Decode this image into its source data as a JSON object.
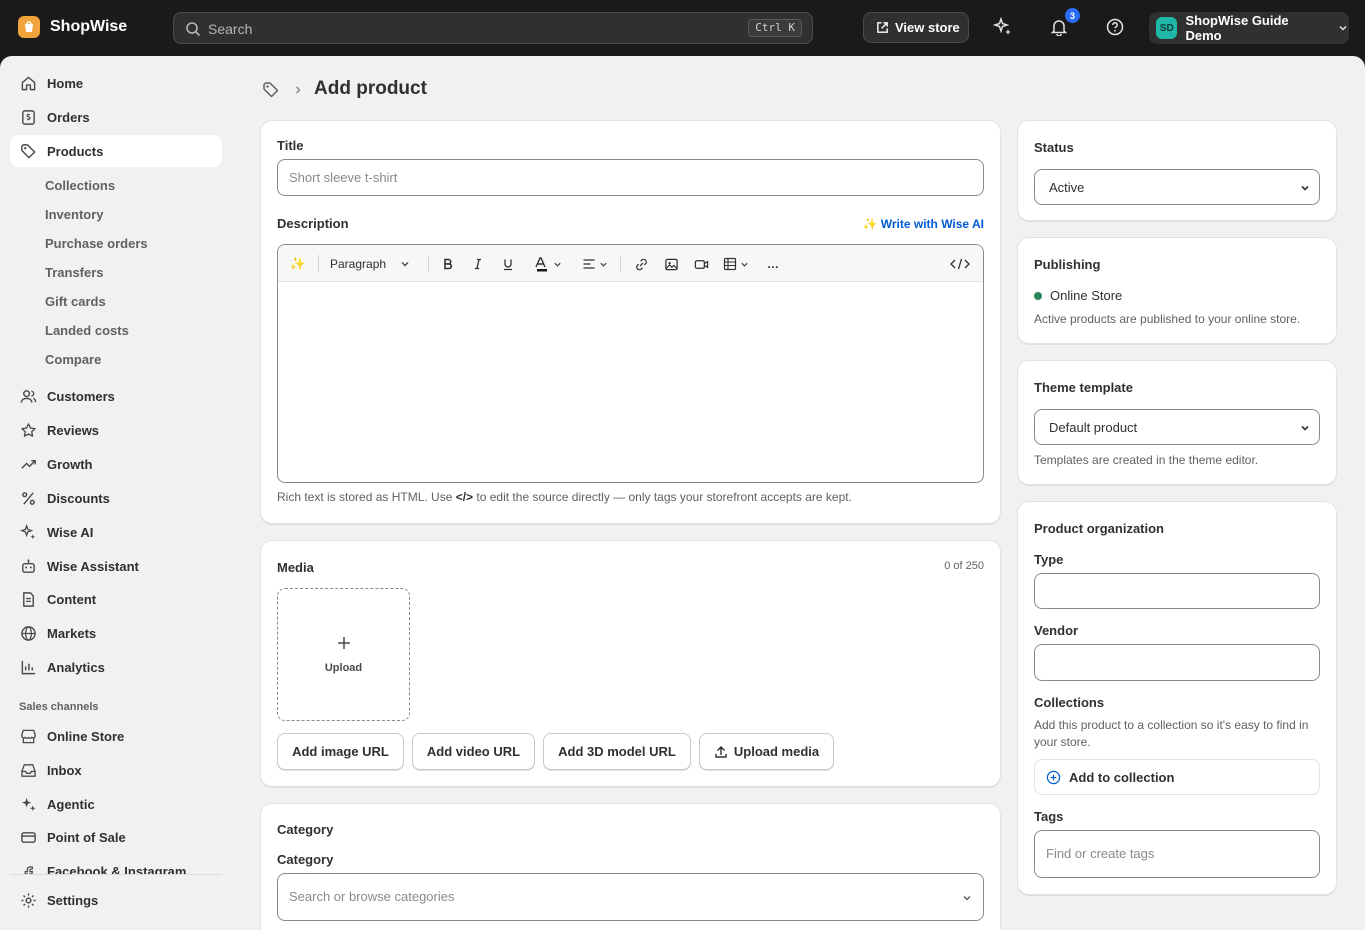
{
  "topbar": {
    "brand": "ShopWise",
    "search_placeholder": "Search",
    "search_shortcut": "Ctrl K",
    "view_store": "View store",
    "notifications_count": "3",
    "account_initials": "SD",
    "account_name": "ShopWise Guide Demo"
  },
  "sidebar": {
    "items": [
      {
        "label": "Home",
        "icon": "home-icon"
      },
      {
        "label": "Orders",
        "icon": "orders-icon"
      },
      {
        "label": "Products",
        "icon": "tag-icon",
        "active": true
      },
      {
        "label": "Customers",
        "icon": "customers-icon"
      },
      {
        "label": "Reviews",
        "icon": "star-icon"
      },
      {
        "label": "Growth",
        "icon": "trend-icon"
      },
      {
        "label": "Discounts",
        "icon": "percent-icon"
      },
      {
        "label": "Wise AI",
        "icon": "sparkle-icon"
      },
      {
        "label": "Wise Assistant",
        "icon": "robot-icon"
      },
      {
        "label": "Content",
        "icon": "content-icon"
      },
      {
        "label": "Markets",
        "icon": "globe-icon"
      },
      {
        "label": "Analytics",
        "icon": "analytics-icon"
      }
    ],
    "product_subitems": [
      "Collections",
      "Inventory",
      "Purchase orders",
      "Transfers",
      "Gift cards",
      "Landed costs",
      "Compare"
    ],
    "sales_channels_label": "Sales channels",
    "channels": [
      {
        "label": "Online Store",
        "icon": "store-icon"
      },
      {
        "label": "Inbox",
        "icon": "inbox-icon"
      },
      {
        "label": "Agentic",
        "icon": "agentic-icon"
      },
      {
        "label": "Point of Sale",
        "icon": "pos-icon"
      },
      {
        "label": "Facebook & Instagram",
        "icon": "facebook-icon"
      }
    ],
    "settings": "Settings"
  },
  "page": {
    "title": "Add product"
  },
  "main_card": {
    "title_label": "Title",
    "title_placeholder": "Short sleeve t-shirt",
    "description_label": "Description",
    "ai_link": "✨ Write with Wise AI",
    "paragraph_select": "Paragraph",
    "more_label": "…",
    "help_text_before": "Rich text is stored as HTML. Use ",
    "help_code": "</>",
    "help_text_after": " to edit the source directly — only tags your storefront accepts are kept."
  },
  "media": {
    "label": "Media",
    "count": "0 of 250",
    "upload": "Upload",
    "buttons": [
      "Add image URL",
      "Add video URL",
      "Add 3D model URL",
      "Upload media"
    ]
  },
  "category": {
    "heading": "Category",
    "label": "Category",
    "placeholder": "Search or browse categories"
  },
  "status": {
    "label": "Status",
    "value": "Active"
  },
  "publishing": {
    "label": "Publishing",
    "channel": "Online Store",
    "note": "Active products are published to your online store.",
    "dot_color": "#29845a"
  },
  "theme": {
    "label": "Theme template",
    "value": "Default product",
    "note": "Templates are created in the theme editor."
  },
  "organization": {
    "label": "Product organization",
    "type_label": "Type",
    "vendor_label": "Vendor",
    "collections_label": "Collections",
    "collections_note": "Add this product to a collection so it's easy to find in your store.",
    "add_collection": "Add to collection",
    "tags_label": "Tags",
    "tags_placeholder": "Find or create tags"
  }
}
